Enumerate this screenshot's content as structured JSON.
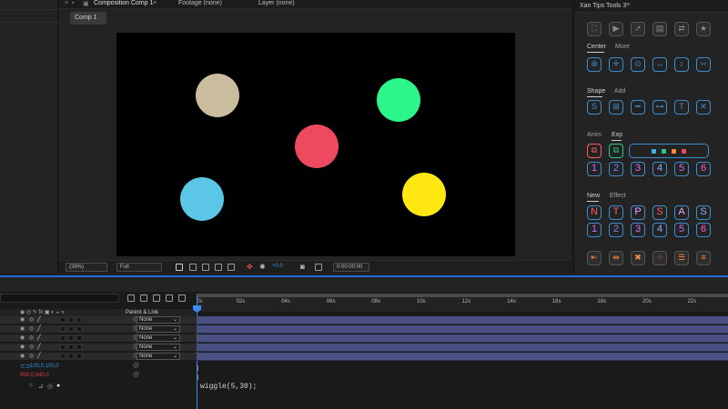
{
  "composition_panel": {
    "tabs": {
      "composition": "Composition Comp 1",
      "footage": "Footage (none)",
      "layer": "Layer (none)"
    },
    "subtab": "Comp 1",
    "toolbar": {
      "zoom": "(39%)",
      "resolution": "Full",
      "exposure": "+0,0",
      "timecode": "0:00:00:00"
    }
  },
  "viewer": {
    "background": "#000000",
    "circles": [
      {
        "name": "beige-circle",
        "color": "#c9bd9d"
      },
      {
        "name": "green-circle",
        "color": "#2cf58a"
      },
      {
        "name": "red-circle",
        "color": "#ee4a5f"
      },
      {
        "name": "blue-circle",
        "color": "#5bc6e6"
      },
      {
        "name": "yellow-circle",
        "color": "#ffe812"
      }
    ]
  },
  "right_panel": {
    "title": "Xan Tips Tools 3",
    "center_tab": "Center",
    "more_tab": "More",
    "shape_tab": "Shape",
    "add_tab": "Add",
    "anim_tab": "Anim",
    "exp_tab": "Exp",
    "new_tab": "New",
    "effect_tab": "Effect",
    "exp_numbers": [
      "1",
      "2",
      "3",
      "4",
      "5",
      "6"
    ],
    "new_letters": [
      "N",
      "T",
      "P",
      "S",
      "A",
      "S"
    ],
    "effect_numbers": [
      "1",
      "2",
      "3",
      "4",
      "5",
      "6"
    ],
    "letter_colors": [
      "#ff5a6a",
      "#ff5a6a",
      "#e8a4ff",
      "#ff5a6a",
      "#e8a4ff",
      "#8fb0ff"
    ],
    "number_colors": [
      "#c66cff",
      "#7b7cff",
      "#c66cff",
      "#8fb0ff",
      "#c66cff",
      "#ff5acb"
    ],
    "swatches": [
      "#3db2d8",
      "#2bc98a",
      "#ff8a3a",
      "#ee4a5f"
    ]
  },
  "timeline": {
    "ruler_labels": [
      "0s",
      "02s",
      "04s",
      "06s",
      "08s",
      "10s",
      "12s",
      "14s",
      "16s",
      "18s",
      "20s",
      "22s"
    ],
    "parent_header": "Parent & Link",
    "layer_parents": [
      "None",
      "None",
      "None",
      "None",
      "None"
    ],
    "scale_value": "100,0,100,0",
    "position_value": "500,0,340,0",
    "expression": "wiggle(5,30);"
  }
}
